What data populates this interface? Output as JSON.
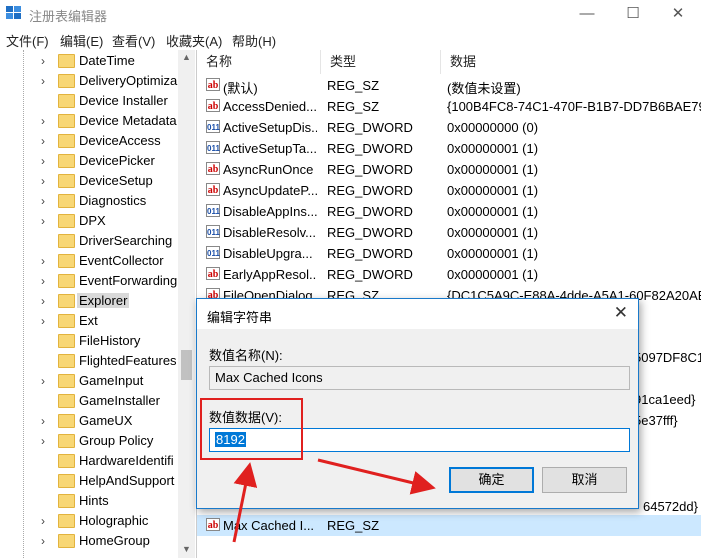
{
  "window": {
    "title": "注册表编辑器",
    "controls": [
      "—",
      "☐",
      "✕"
    ]
  },
  "menu": [
    "文件(F)",
    "编辑(E)",
    "查看(V)",
    "收藏夹(A)",
    "帮助(H)"
  ],
  "tree": {
    "items": [
      {
        "label": "DateTime",
        "expandable": true
      },
      {
        "label": "DeliveryOptimiza",
        "expandable": true
      },
      {
        "label": "Device Installer",
        "expandable": false
      },
      {
        "label": "Device Metadata",
        "expandable": true
      },
      {
        "label": "DeviceAccess",
        "expandable": true
      },
      {
        "label": "DevicePicker",
        "expandable": true
      },
      {
        "label": "DeviceSetup",
        "expandable": true
      },
      {
        "label": "Diagnostics",
        "expandable": true
      },
      {
        "label": "DPX",
        "expandable": true
      },
      {
        "label": "DriverSearching",
        "expandable": false
      },
      {
        "label": "EventCollector",
        "expandable": true
      },
      {
        "label": "EventForwarding",
        "expandable": true
      },
      {
        "label": "Explorer",
        "expandable": true,
        "selected": true
      },
      {
        "label": "Ext",
        "expandable": true
      },
      {
        "label": "FileHistory",
        "expandable": false
      },
      {
        "label": "FlightedFeatures",
        "expandable": false
      },
      {
        "label": "GameInput",
        "expandable": true
      },
      {
        "label": "GameInstaller",
        "expandable": false
      },
      {
        "label": "GameUX",
        "expandable": true
      },
      {
        "label": "Group Policy",
        "expandable": true
      },
      {
        "label": "HardwareIdentifi",
        "expandable": false
      },
      {
        "label": "HelpAndSupport",
        "expandable": false
      },
      {
        "label": "Hints",
        "expandable": false
      },
      {
        "label": "Holographic",
        "expandable": true
      },
      {
        "label": "HomeGroup",
        "expandable": true
      }
    ]
  },
  "list": {
    "headers": [
      "名称",
      "类型",
      "数据"
    ],
    "rows": [
      {
        "icon": "sz",
        "name": "(默认)",
        "type": "REG_SZ",
        "data": "(数值未设置)"
      },
      {
        "icon": "sz",
        "name": "AccessDenied...",
        "type": "REG_SZ",
        "data": "{100B4FC8-74C1-470F-B1B7-DD7B6BAE79B"
      },
      {
        "icon": "dw",
        "name": "ActiveSetupDis...",
        "type": "REG_DWORD",
        "data": "0x00000000 (0)"
      },
      {
        "icon": "dw",
        "name": "ActiveSetupTa...",
        "type": "REG_DWORD",
        "data": "0x00000001 (1)"
      },
      {
        "icon": "sz",
        "name": "AsyncRunOnce",
        "type": "REG_DWORD",
        "data": "0x00000001 (1)"
      },
      {
        "icon": "sz",
        "name": "AsyncUpdateP...",
        "type": "REG_DWORD",
        "data": "0x00000001 (1)"
      },
      {
        "icon": "dw",
        "name": "DisableAppIns...",
        "type": "REG_DWORD",
        "data": "0x00000001 (1)"
      },
      {
        "icon": "dw",
        "name": "DisableResolv...",
        "type": "REG_DWORD",
        "data": "0x00000001 (1)"
      },
      {
        "icon": "dw",
        "name": "DisableUpgra...",
        "type": "REG_DWORD",
        "data": "0x00000001 (1)"
      },
      {
        "icon": "sz",
        "name": "EarlyAppResol...",
        "type": "REG_DWORD",
        "data": "0x00000001 (1)"
      },
      {
        "icon": "sz",
        "name": "FileOpenDialog",
        "type": "REG_SZ",
        "data": "{DC1C5A9C-E88A-4dde-A5A1-60F82A20AEF"
      }
    ],
    "partial_data": [
      "5097DF8C1",
      "91ca1eed}",
      "5e37fff}",
      "64572dd}"
    ],
    "bottom_row": {
      "icon": "sz",
      "name": "Max Cached I...",
      "type": "REG_SZ"
    }
  },
  "dialog": {
    "title": "编辑字符串",
    "name_label": "数值名称(N):",
    "name_value": "Max Cached Icons",
    "data_label": "数值数据(V):",
    "data_value": "8192",
    "ok_label": "确定",
    "cancel_label": "取消"
  },
  "colors": {
    "annotation": "#e0201f",
    "accent": "#0078d7",
    "selection": "#cce8ff"
  }
}
